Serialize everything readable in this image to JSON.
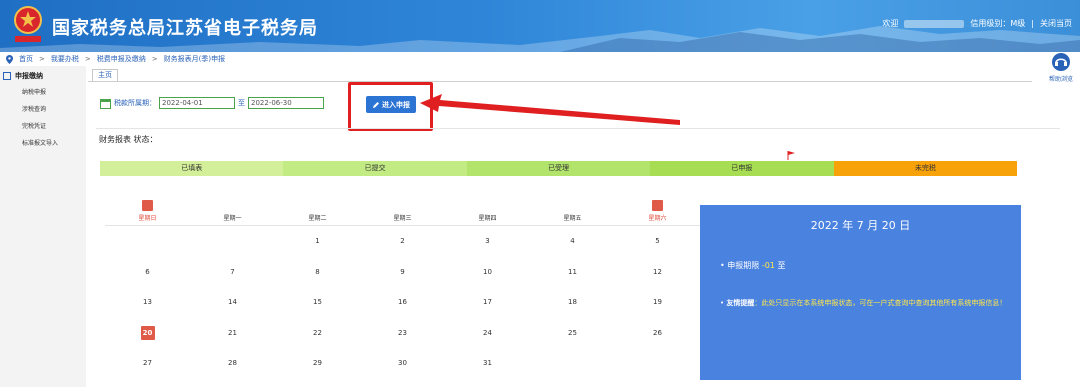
{
  "header": {
    "title": "国家税务总局江苏省电子税务局",
    "welcome": "欢迎",
    "credit_label": "信用级别：M级",
    "close_label": "关闭当页"
  },
  "breadcrumb": [
    "首页",
    "我要办税",
    "税费申报及缴纳",
    "财务报表月(季)申报"
  ],
  "sidebar": {
    "group_label": "申报缴纳",
    "items": [
      "纳税申报",
      "涉税查询",
      "完税凭证",
      "标准报文导入"
    ]
  },
  "tab": "主页",
  "help_label": "帮助浏览",
  "period": {
    "label": "税款所属期：",
    "start": "2022-04-01",
    "to": "至",
    "end": "2022-06-30"
  },
  "enter_button": "进入申报",
  "status_label": "财务报表 状态：",
  "status_steps": [
    {
      "label": "已填表",
      "color": "#d4ef9a"
    },
    {
      "label": "已提交",
      "color": "#c2eb84"
    },
    {
      "label": "已受理",
      "color": "#b2e46c"
    },
    {
      "label": "已申报",
      "color": "#a7dd52"
    },
    {
      "label": "未完税",
      "color": "#f8a20a"
    }
  ],
  "calendar": {
    "weekdays": [
      "星期日",
      "星期一",
      "星期二",
      "星期三",
      "星期四",
      "星期五",
      "星期六"
    ],
    "weeks": [
      [
        "",
        "",
        "1",
        "2",
        "3",
        "4",
        "5"
      ],
      [
        "6",
        "7",
        "8",
        "9",
        "10",
        "11",
        "12"
      ],
      [
        "13",
        "14",
        "15",
        "16",
        "17",
        "18",
        "19"
      ],
      [
        "20",
        "21",
        "22",
        "23",
        "24",
        "25",
        "26"
      ],
      [
        "27",
        "28",
        "29",
        "30",
        "31",
        "",
        ""
      ]
    ],
    "today": "20"
  },
  "info": {
    "date": "2022 年 7 月 20 日",
    "period_label": "申报期限",
    "period_value": "-01",
    "period_to": "至",
    "tip_label": "友情提醒",
    "tip_text": "：此处只显示在本系统申报状态，可在一户式查询中查询其他所有系统申报信息！"
  },
  "colors": {
    "header": "#2f86d8",
    "accent": "#2b74d4",
    "highlight": "#e02020",
    "info_panel": "#4a82e0",
    "today": "#e05a4a"
  }
}
